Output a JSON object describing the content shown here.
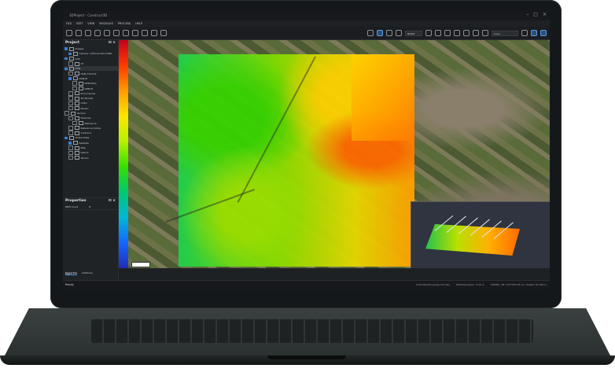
{
  "window": {
    "title": "3DProject - Construct3D"
  },
  "menu": [
    "FILE",
    "EDIT",
    "VIEW",
    "MODULES",
    "PROCESS",
    "HELP"
  ],
  "toolbar": {
    "view_select": "NDSM",
    "color_select": "Color"
  },
  "project_panel": {
    "title": "Project",
    "items": [
      {
        "label": "Images",
        "checked": true,
        "indent": 0
      },
      {
        "label": "Camera 1 (Phone Dev DSM)",
        "checked": true,
        "indent": 1
      },
      {
        "label": "GCP",
        "checked": true,
        "indent": 0
      },
      {
        "label": "AT",
        "checked": false,
        "indent": 1
      },
      {
        "label": "DSM",
        "checked": true,
        "indent": 0,
        "selected": true
      },
      {
        "label": "DSM_Third.tif",
        "checked": false,
        "indent": 1
      },
      {
        "label": "DSM.tif",
        "checked": true,
        "indent": 1
      },
      {
        "label": "DEM.tif(5)",
        "checked": false,
        "indent": 2
      },
      {
        "label": "DPM.tif",
        "checked": false,
        "indent": 2
      },
      {
        "label": "Point Clouds",
        "checked": false,
        "indent": 1
      },
      {
        "label": "3D Models",
        "checked": false,
        "indent": 1
      },
      {
        "label": "Ortho",
        "checked": false,
        "indent": 1
      },
      {
        "label": "Mosaic",
        "checked": false,
        "indent": 1
      },
      {
        "label": "Vectors",
        "checked": false,
        "indent": 0
      },
      {
        "label": "Features",
        "checked": false,
        "indent": 1
      },
      {
        "label": "Reference",
        "checked": false,
        "indent": 2
      },
      {
        "label": "Reference Online",
        "checked": false,
        "indent": 1
      },
      {
        "label": "Contours",
        "checked": false,
        "indent": 1
      },
      {
        "label": "Online Data",
        "checked": true,
        "indent": 0
      },
      {
        "label": "Satellite",
        "checked": true,
        "indent": 1
      },
      {
        "label": "Map",
        "checked": false,
        "indent": 1
      },
      {
        "label": "Hybrid",
        "checked": false,
        "indent": 1
      },
      {
        "label": "Terrain",
        "checked": false,
        "indent": 1
      }
    ]
  },
  "properties_panel": {
    "title": "Properties",
    "rows": [
      {
        "key": "DEM count",
        "value": "8"
      }
    ],
    "tabs": [
      "Properties",
      "Outliners"
    ]
  },
  "log": {
    "label": "Log"
  },
  "status": {
    "left": "Ready",
    "right": [
      "LAS3 Medium(Large Format)",
      "DSM Resolution: 0.25 m",
      "248383, 1ft: 3727355.28 Lm, Height: 35.298 m"
    ]
  },
  "colors": {
    "accent": "#3b7fd6",
    "background": "#1e2124"
  }
}
